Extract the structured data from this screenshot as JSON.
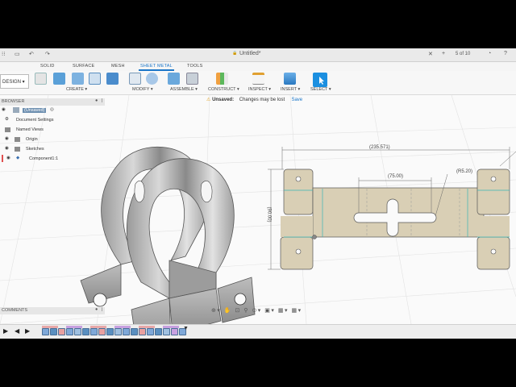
{
  "titlebar": {
    "doc_title": "Untitled*",
    "page_counter": "5 of 10"
  },
  "tabs": [
    "SOLID",
    "SURFACE",
    "MESH",
    "SHEET METAL",
    "TOOLS"
  ],
  "active_tab": "SHEET METAL",
  "workspace_button": "DESIGN",
  "ribbon_groups": [
    "CREATE",
    "MODIFY",
    "ASSEMBLE",
    "CONSTRUCT",
    "INSPECT",
    "INSERT",
    "SELECT"
  ],
  "browser": {
    "header": "BROWSER",
    "items": [
      {
        "label": "(Unsaved)"
      },
      {
        "label": "Document Settings"
      },
      {
        "label": "Named Views"
      },
      {
        "label": "Origin"
      },
      {
        "label": "Sketches"
      },
      {
        "label": "Component1:1"
      }
    ]
  },
  "notice": {
    "status": "Unsaved:",
    "message": "Changes may be lost",
    "save_label": "Save"
  },
  "drawing": {
    "dim_overall": "(235.571)",
    "dim_slot": "(75.00)",
    "dim_radius": "(R5.20)",
    "dim_height": "(90.00)"
  },
  "comments_label": "COMMENTS",
  "colors": {
    "accent": "#1b76c8",
    "flat_pattern": "#d9cfb5",
    "bend_line": "#39b6b6",
    "background": "#fafafa"
  }
}
